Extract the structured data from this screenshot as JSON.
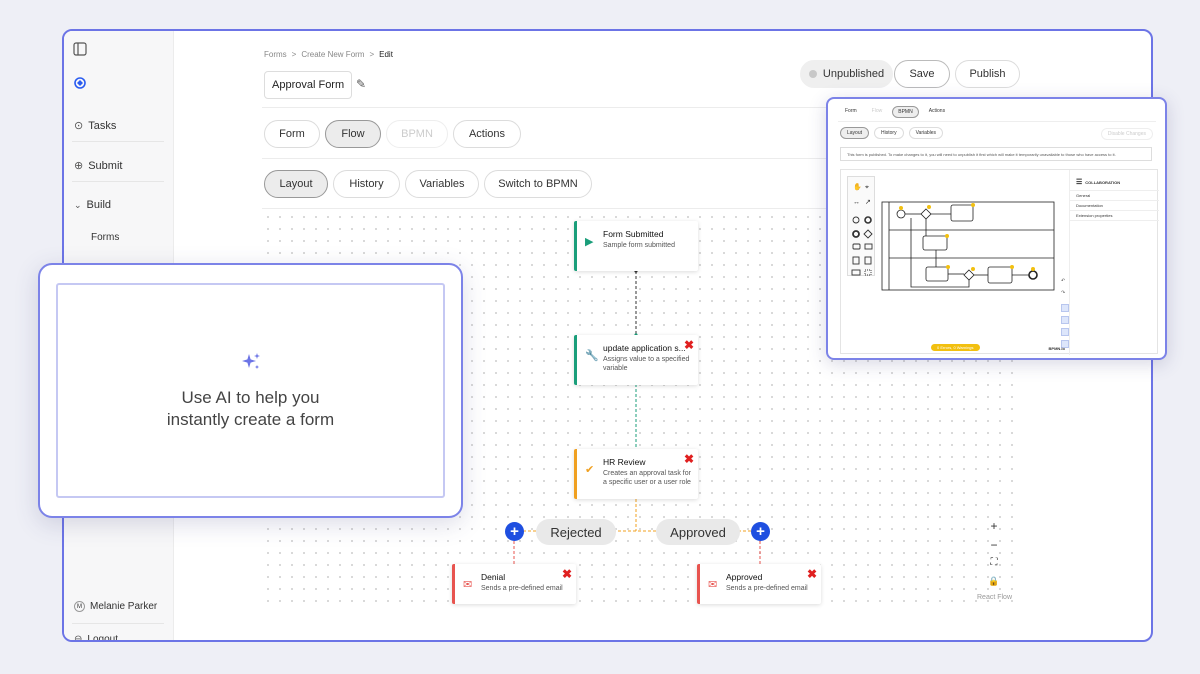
{
  "sidebar": {
    "items": [
      {
        "label": "Tasks",
        "icon": "check-circle-icon"
      },
      {
        "label": "Submit",
        "icon": "arrow-up-circle-icon"
      },
      {
        "label": "Build",
        "icon": "chevron-down-icon"
      }
    ],
    "sub_items": [
      {
        "label": "Forms"
      }
    ],
    "user_name": "Melanie Parker",
    "user_initial": "M",
    "logout_label": "Logout"
  },
  "breadcrumb": {
    "items": [
      "Forms",
      "Create New Form",
      "Edit"
    ],
    "separator": ">"
  },
  "form_title": "Approval Form",
  "header": {
    "status_label": "Unpublished",
    "save_label": "Save",
    "publish_label": "Publish"
  },
  "tabs": [
    {
      "label": "Form",
      "state": "normal"
    },
    {
      "label": "Flow",
      "state": "selected"
    },
    {
      "label": "BPMN",
      "state": "disabled"
    },
    {
      "label": "Actions",
      "state": "normal"
    }
  ],
  "subtabs": [
    {
      "label": "Layout",
      "state": "selected"
    },
    {
      "label": "History",
      "state": "normal"
    },
    {
      "label": "Variables",
      "state": "normal"
    },
    {
      "label": "Switch to BPMN",
      "state": "normal"
    }
  ],
  "flow": {
    "nodes": [
      {
        "title": "Form Submitted",
        "desc": "Sample form submitted",
        "icon": "play-circle-icon",
        "accent": "#1a9e7a",
        "deletable": false
      },
      {
        "title": "update application s...",
        "desc": "Assigns value to a specified variable",
        "icon": "wrench-icon",
        "accent": "#1a9e7a",
        "deletable": true
      },
      {
        "title": "HR Review",
        "desc": "Creates an approval task for a specific user or a user role",
        "icon": "check-circle-icon",
        "accent": "#f0a020",
        "deletable": true
      },
      {
        "title": "Denial",
        "desc": "Sends a pre-defined email",
        "icon": "mail-icon",
        "accent": "#e8544f",
        "deletable": true
      },
      {
        "title": "Approved",
        "desc": "Sends a pre-defined email",
        "icon": "mail-icon",
        "accent": "#e8544f",
        "deletable": true
      }
    ],
    "branches": {
      "rejected_label": "Rejected",
      "approved_label": "Approved"
    },
    "controls": [
      "+",
      "−",
      "⛶",
      "🔒"
    ],
    "attribution": "React Flow"
  },
  "ai_card": {
    "line1": "Use AI to help you",
    "line2": "instantly create a form",
    "icon": "sparkles-icon"
  },
  "bpmn_preview": {
    "tabs": [
      "Form",
      "Flow",
      "BPMN",
      "Actions"
    ],
    "subtabs": [
      "Layout",
      "History",
      "Variables"
    ],
    "right_button": "Disable Changes",
    "notice": "This form is published. To make changes to it, you will need to unpublish it first which will make it temporarily unavailable to those who have access to it.",
    "panel_title": "COLLABORATION",
    "panel_rows": [
      "General",
      "Documentation",
      "Extension properties"
    ],
    "status_badge": "0 Errors, 0 Warnings",
    "logo_text": "BPMN.io"
  },
  "colors": {
    "accent": "#6c74e6",
    "plus": "#1f4fe0",
    "delete": "#e02020",
    "green": "#1a9e7a",
    "orange": "#f0a020",
    "red": "#e8544f"
  }
}
